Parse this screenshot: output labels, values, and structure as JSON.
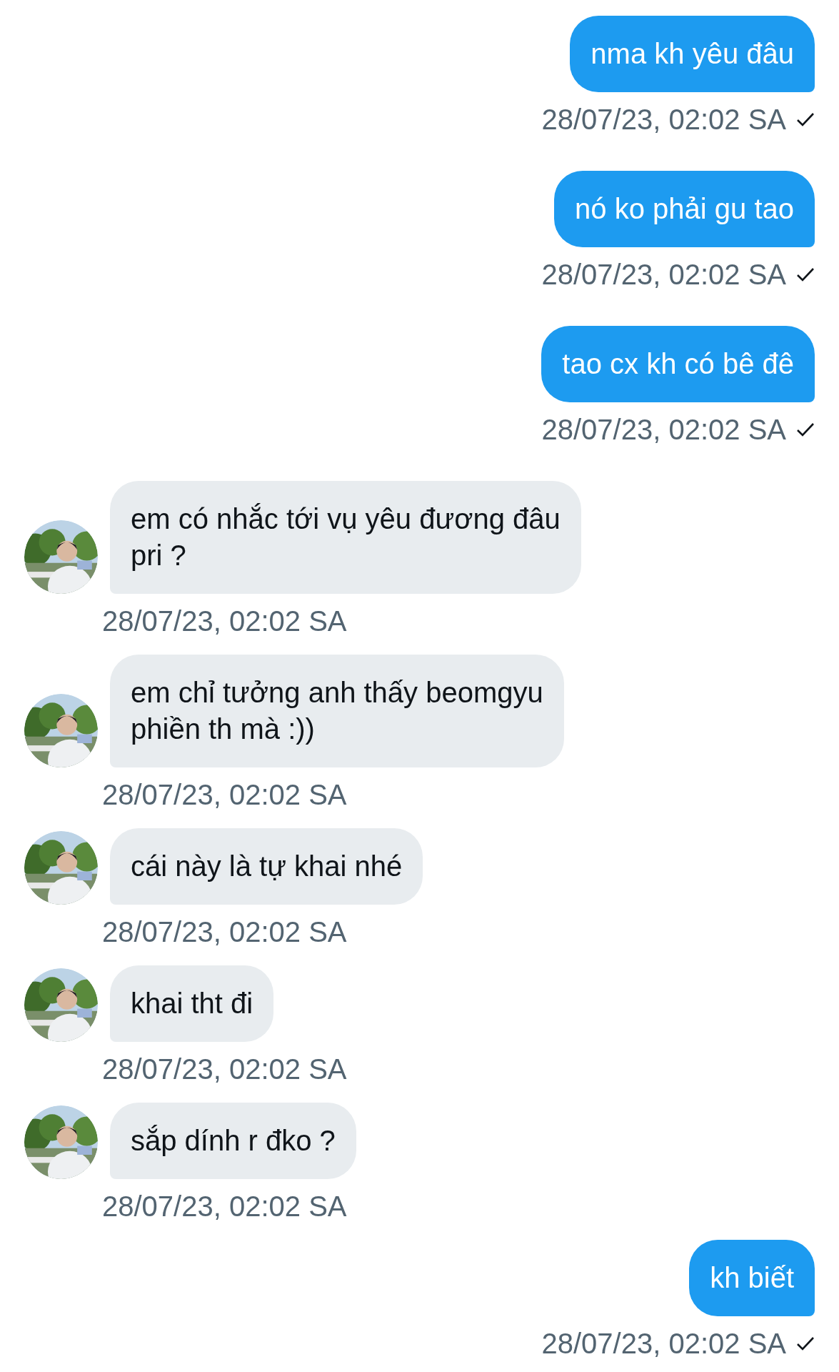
{
  "messages": [
    {
      "kind": "sent",
      "text": "nma kh yêu đâu",
      "time": "28/07/23, 02:02 SA",
      "delivered": true
    },
    {
      "kind": "sent",
      "text": "nó ko phải gu tao",
      "time": "28/07/23, 02:02 SA",
      "delivered": true
    },
    {
      "kind": "sent",
      "text": "tao cx kh có bê đê",
      "time": "28/07/23, 02:02 SA",
      "delivered": true
    },
    {
      "kind": "received",
      "text": "em có nhắc tới vụ yêu đương đâu\npri ?",
      "time": "28/07/23, 02:02 SA"
    },
    {
      "kind": "received",
      "text": "em chỉ tưởng anh thấy beomgyu\nphiền th mà :))",
      "time": "28/07/23, 02:02 SA"
    },
    {
      "kind": "received",
      "text": "cái này là tự khai nhé",
      "time": "28/07/23, 02:02 SA"
    },
    {
      "kind": "received",
      "text": "khai tht đi",
      "time": "28/07/23, 02:02 SA"
    },
    {
      "kind": "received",
      "text": "sắp dính r đko ?",
      "time": "28/07/23, 02:02 SA"
    },
    {
      "kind": "sent",
      "text": "kh biết",
      "time": "28/07/23, 02:02 SA",
      "delivered": true
    }
  ]
}
